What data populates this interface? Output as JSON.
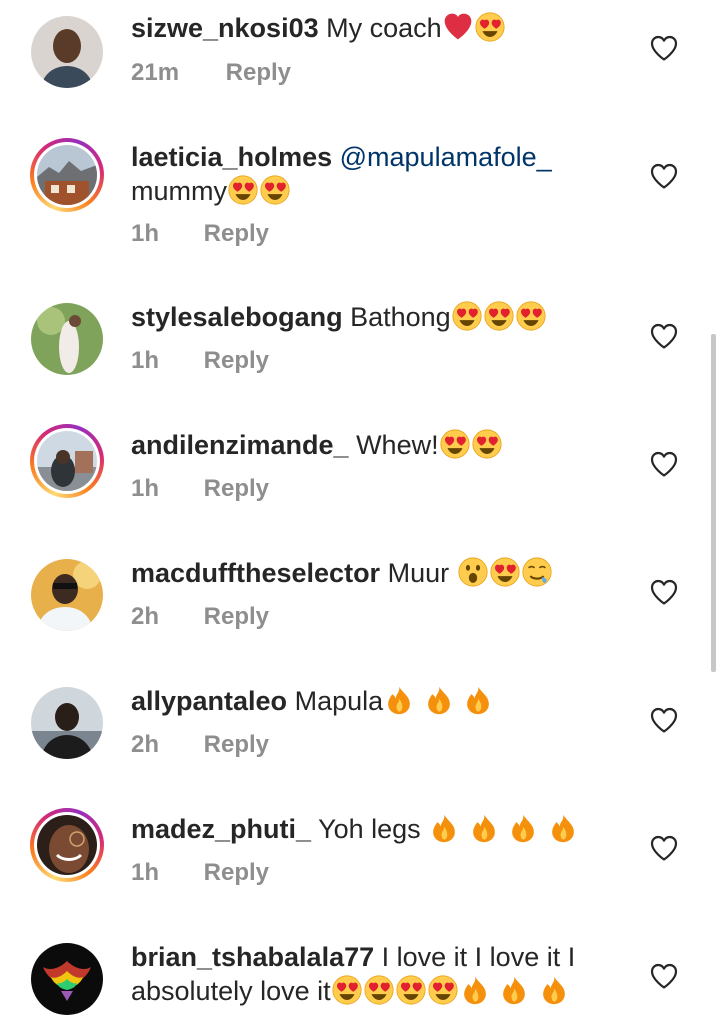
{
  "comments": [
    {
      "username": "sizwe_nkosi03",
      "text": "My coach",
      "time": "21m",
      "reply": "Reply"
    },
    {
      "username": "laeticia_holmes",
      "mention": "@mapulamafole_",
      "text": "mummy",
      "time": "1h",
      "reply": "Reply"
    },
    {
      "username": "stylesalebogang",
      "text": "Bathong",
      "time": "1h",
      "reply": "Reply"
    },
    {
      "username": "andilenzimande_",
      "text": "Whew!",
      "time": "1h",
      "reply": "Reply"
    },
    {
      "username": "macdufftheselector",
      "text": "Muur",
      "time": "2h",
      "reply": "Reply"
    },
    {
      "username": "allypantaleo",
      "text": "Mapula",
      "time": "2h",
      "reply": "Reply"
    },
    {
      "username": "madez_phuti_",
      "text": "Yoh legs",
      "time": "1h",
      "reply": "Reply"
    },
    {
      "username": "brian_tshabalala77",
      "text": "I love it I love it I absolutely love it",
      "time": "",
      "reply": ""
    }
  ],
  "icons": {
    "like": "heart-outline-icon",
    "emoji_heart_eyes": "heart-eyes-emoji",
    "emoji_red_heart": "red-heart-emoji",
    "emoji_fire": "fire-emoji",
    "emoji_open_mouth": "open-mouth-emoji",
    "emoji_drooling": "drooling-emoji"
  },
  "colors": {
    "text": "#262626",
    "meta": "#8e8e8e",
    "mention": "#003569",
    "story_ring": "#d62976"
  }
}
